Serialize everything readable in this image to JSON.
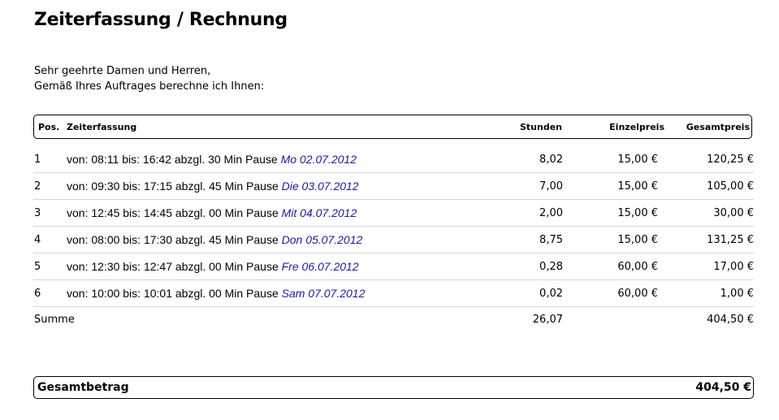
{
  "title": "Zeiterfassung / Rechnung",
  "greeting": {
    "line1": "Sehr geehrte Damen und Herren,",
    "line2": "Gemäß Ihres Auftrages berechne ich Ihnen:"
  },
  "table": {
    "headers": {
      "pos": "Pos.",
      "zeit": "Zeiterfassung",
      "stunden": "Stunden",
      "einzelpreis": "Einzelpreis",
      "gesamtpreis": "Gesamtpreis"
    },
    "rows": [
      {
        "pos": "1",
        "desc": "von: 08:11 bis: 16:42 abzgl. 30 Min Pause",
        "date": "Mo 02.07.2012",
        "stunden": "8,02",
        "einzel": "15,00 €",
        "gesamt": "120,25 €"
      },
      {
        "pos": "2",
        "desc": "von: 09:30 bis: 17:15 abzgl. 45 Min Pause",
        "date": "Die 03.07.2012",
        "stunden": "7,00",
        "einzel": "15,00 €",
        "gesamt": "105,00 €"
      },
      {
        "pos": "3",
        "desc": "von: 12:45 bis: 14:45 abzgl. 00 Min Pause",
        "date": "Mit 04.07.2012",
        "stunden": "2,00",
        "einzel": "15,00 €",
        "gesamt": "30,00 €"
      },
      {
        "pos": "4",
        "desc": "von: 08:00 bis: 17:30 abzgl. 45 Min Pause",
        "date": "Don 05.07.2012",
        "stunden": "8,75",
        "einzel": "15,00 €",
        "gesamt": "131,25 €"
      },
      {
        "pos": "5",
        "desc": "von: 12:30 bis: 12:47 abzgl. 00 Min Pause",
        "date": "Fre 06.07.2012",
        "stunden": "0,28",
        "einzel": "60,00 €",
        "gesamt": "17,00 €"
      },
      {
        "pos": "6",
        "desc": "von: 10:00 bis: 10:01 abzgl. 00 Min Pause",
        "date": "Sam 07.07.2012",
        "stunden": "0,02",
        "einzel": "60,00 €",
        "gesamt": "1,00 €"
      }
    ]
  },
  "summe": {
    "label": "Summe",
    "stunden": "26,07",
    "gesamt": "404,50 €"
  },
  "gesamtbetrag": {
    "label": "Gesamtbetrag",
    "value": "404,50 €"
  },
  "colors": {
    "date": "#1a1aa8",
    "divider": "#d6d6d6"
  }
}
